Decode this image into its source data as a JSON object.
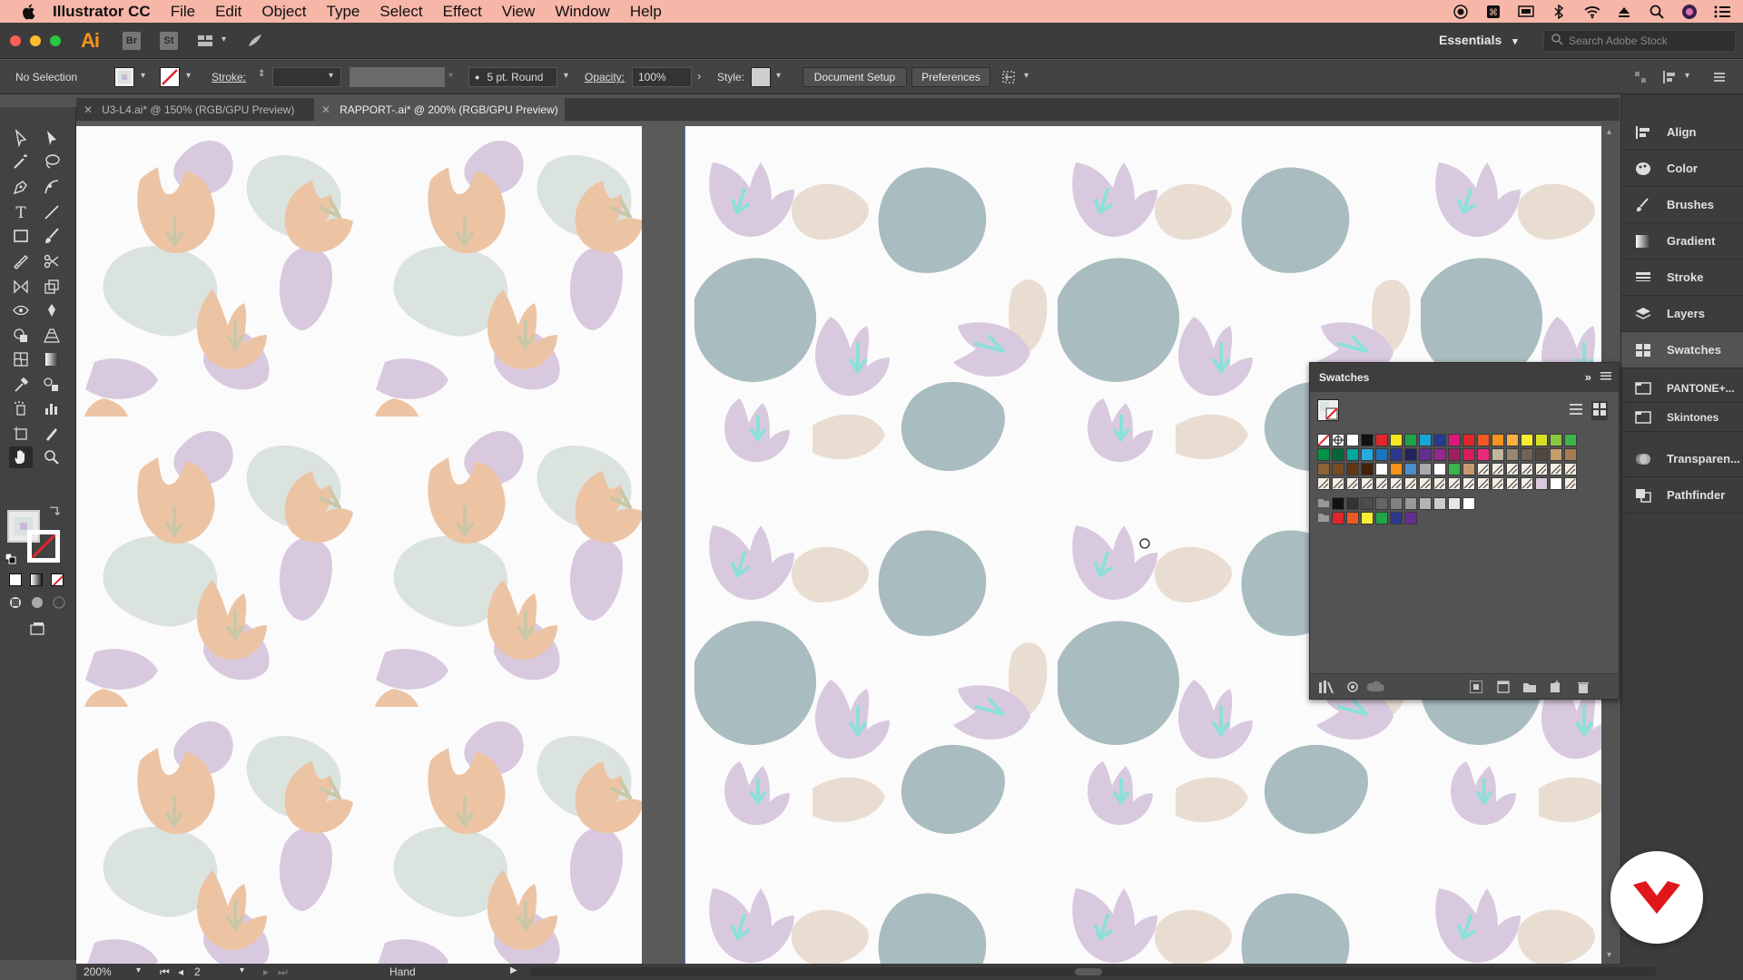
{
  "menubar": {
    "app_name": "Illustrator CC",
    "items": [
      "File",
      "Edit",
      "Object",
      "Type",
      "Select",
      "Effect",
      "View",
      "Window",
      "Help"
    ]
  },
  "appbar": {
    "logo": "Ai",
    "bridge": "Br",
    "stock": "St",
    "workspace": "Essentials",
    "search_placeholder": "Search Adobe Stock"
  },
  "control": {
    "selection": "No Selection",
    "stroke_label": "Stroke:",
    "brush": "5 pt. Round",
    "opacity_label": "Opacity:",
    "opacity_value": "100%",
    "style_label": "Style:",
    "doc_setup": "Document Setup",
    "preferences": "Preferences"
  },
  "tabs": [
    {
      "label": "U3-L4.ai* @ 150% (RGB/GPU Preview)",
      "active": false
    },
    {
      "label": "RAPPORT-.ai* @ 200% (RGB/GPU Preview)",
      "active": true
    }
  ],
  "dock": {
    "items": [
      "Align",
      "Color",
      "Brushes",
      "Gradient",
      "Stroke",
      "Layers",
      "Swatches",
      "PANTONE+...",
      "Skintones",
      "Transparen...",
      "Pathfinder"
    ],
    "active": "Swatches"
  },
  "swatches_panel": {
    "title": "Swatches"
  },
  "status": {
    "zoom": "200%",
    "artboard": "2",
    "tool": "Hand"
  },
  "colors": {
    "menubar": "#f6b6a8",
    "peach": "#ecc4a4",
    "lilac": "#d9c9df",
    "sage": "#dbe3df",
    "slate": "#a9bcbf",
    "beige": "#e9ddd2",
    "mint": "#8ce0d8"
  }
}
